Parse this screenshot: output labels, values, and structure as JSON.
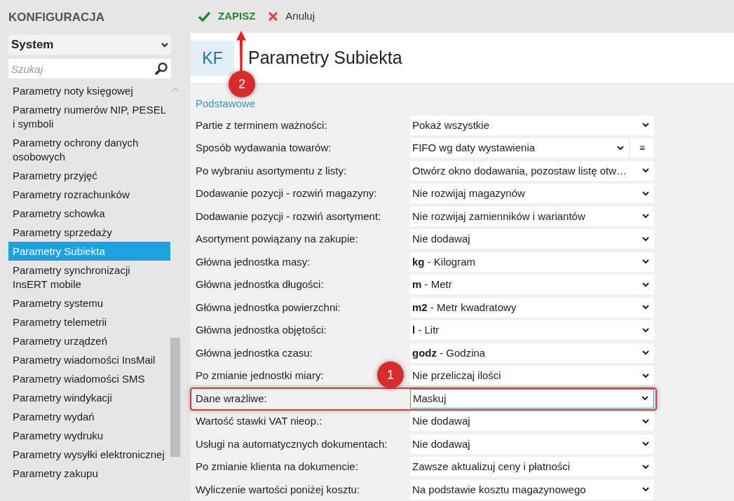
{
  "sidebar": {
    "title": "KONFIGURACJA",
    "group": "System",
    "search": {
      "placeholder": "Szukaj"
    },
    "items": [
      {
        "label": "Parametry noty księgowej",
        "selected": false
      },
      {
        "label": "Parametry numerów NIP, PESEL i symboli",
        "selected": false
      },
      {
        "label": "Parametry ochrony danych osobowych",
        "selected": false
      },
      {
        "label": "Parametry przyjęć",
        "selected": false
      },
      {
        "label": "Parametry rozrachunków",
        "selected": false
      },
      {
        "label": "Parametry schowka",
        "selected": false
      },
      {
        "label": "Parametry sprzedaży",
        "selected": false
      },
      {
        "label": "Parametry Subiekta",
        "selected": true
      },
      {
        "label": "Parametry synchronizacji InsERT mobile",
        "selected": false
      },
      {
        "label": "Parametry systemu",
        "selected": false
      },
      {
        "label": "Parametry telemetrii",
        "selected": false
      },
      {
        "label": "Parametry urządzeń",
        "selected": false
      },
      {
        "label": "Parametry wiadomości InsMail",
        "selected": false
      },
      {
        "label": "Parametry wiadomości SMS",
        "selected": false
      },
      {
        "label": "Parametry windykacji",
        "selected": false
      },
      {
        "label": "Parametry wydań",
        "selected": false
      },
      {
        "label": "Parametry wydruku",
        "selected": false
      },
      {
        "label": "Parametry wysyłki elektronicznej",
        "selected": false
      },
      {
        "label": "Parametry zakupu",
        "selected": false
      }
    ]
  },
  "toolbar": [
    {
      "kind": "save",
      "label": "ZAPISZ"
    },
    {
      "kind": "cancel",
      "label": "Anuluj"
    }
  ],
  "header": {
    "badge": "KF",
    "title": "Parametry Subiekta"
  },
  "section": "Podstawowe",
  "rows": [
    {
      "label": "Partie z terminem ważności:",
      "value": "Pokaż wszystkie",
      "highlighted": false
    },
    {
      "label": "Sposób wydawania towarów:",
      "value": "FIFO wg daty wystawienia",
      "menu_button": "≡",
      "highlighted": false
    },
    {
      "label": "Po wybraniu asortymentu z listy:",
      "value": "Otwórz okno dodawania, pozostaw listę otw…",
      "highlighted": false
    },
    {
      "label": "Dodawanie pozycji - rozwiń magazyny:",
      "value": "Nie rozwijaj magazynów",
      "highlighted": false
    },
    {
      "label": "Dodawanie pozycji - rozwiń asortyment:",
      "value": "Nie rozwijaj zamienników i wariantów",
      "highlighted": false
    },
    {
      "label": "Asortyment powiązany na zakupie:",
      "value": "Nie dodawaj",
      "highlighted": false
    },
    {
      "label": "Główna jednostka masy:",
      "value": "**kg** - Kilogram",
      "highlighted": false
    },
    {
      "label": "Główna jednostka długości:",
      "value": "**m** - Metr",
      "highlighted": false
    },
    {
      "label": "Główna jednostka powierzchni:",
      "value": "**m2** - Metr kwadratowy",
      "highlighted": false
    },
    {
      "label": "Główna jednostka objętości:",
      "value": "**l** - Litr",
      "highlighted": false
    },
    {
      "label": "Główna jednostka czasu:",
      "value": "**godz** - Godzina",
      "highlighted": false
    },
    {
      "label": "Po zmianie jednostki miary:",
      "value": "Nie przeliczaj ilości",
      "highlighted": false
    },
    {
      "label": "Dane wrażliwe:",
      "value": "Maskuj",
      "highlighted": true
    },
    {
      "label": "Wartość stawki VAT nieop.:",
      "value": "Nie dodawaj",
      "highlighted": false
    },
    {
      "label": "Usługi na automatycznych dokumentach:",
      "value": "Nie dodawaj",
      "highlighted": false
    },
    {
      "label": "Po zmianie klienta na dokumencie:",
      "value": "Zawsze aktualizuj ceny i płatności",
      "highlighted": false
    },
    {
      "label": "Wyliczenie wartości poniżej kosztu:",
      "value": "Na podstawie kosztu magazynowego",
      "highlighted": false
    }
  ],
  "annotations": [
    {
      "number": "1"
    },
    {
      "number": "2"
    }
  ]
}
